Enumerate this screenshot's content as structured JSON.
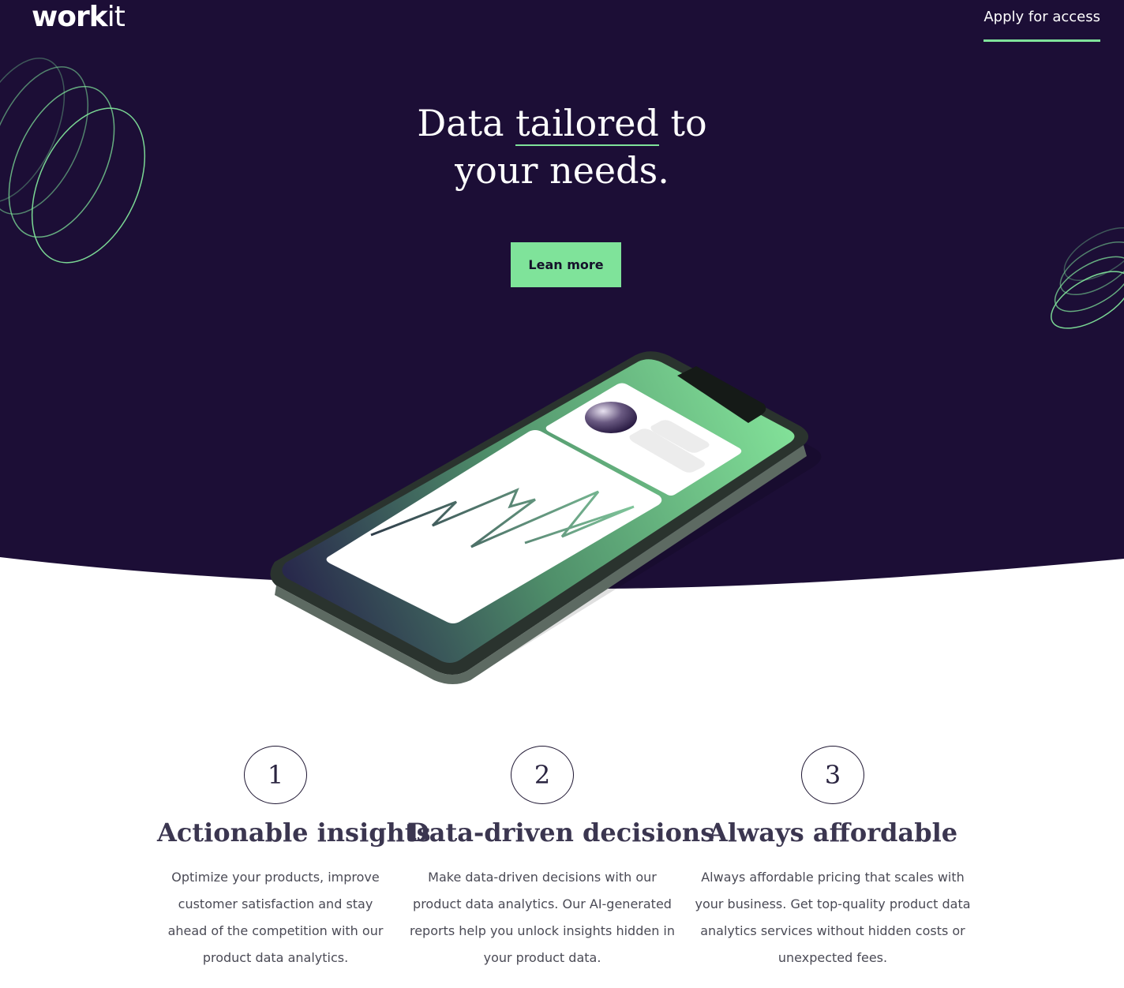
{
  "brand": {
    "logo_bold": "work",
    "logo_light": "it"
  },
  "nav": {
    "apply_label": "Apply for access"
  },
  "hero": {
    "headline_pre": "Data ",
    "headline_em": "tailored",
    "headline_post": " to",
    "headline_line2": "your needs.",
    "cta_label": "Lean more"
  },
  "colors": {
    "background": "#1c0e36",
    "accent": "#7fe39a",
    "text_dark": "#3b3650"
  },
  "features": [
    {
      "number": "1",
      "title": "Actionable insights",
      "text": "Optimize your products, improve customer satisfaction and stay ahead of the competition with our product data analytics."
    },
    {
      "number": "2",
      "title": "Data-driven decisions",
      "text": "Make data-driven decisions with our product data analytics. Our AI-generated reports help you unlock insights hidden in your product data."
    },
    {
      "number": "3",
      "title": "Always affordable",
      "text": "Always affordable pricing that scales with your business. Get top-quality product data analytics services without hidden costs or unexpected fees."
    }
  ]
}
